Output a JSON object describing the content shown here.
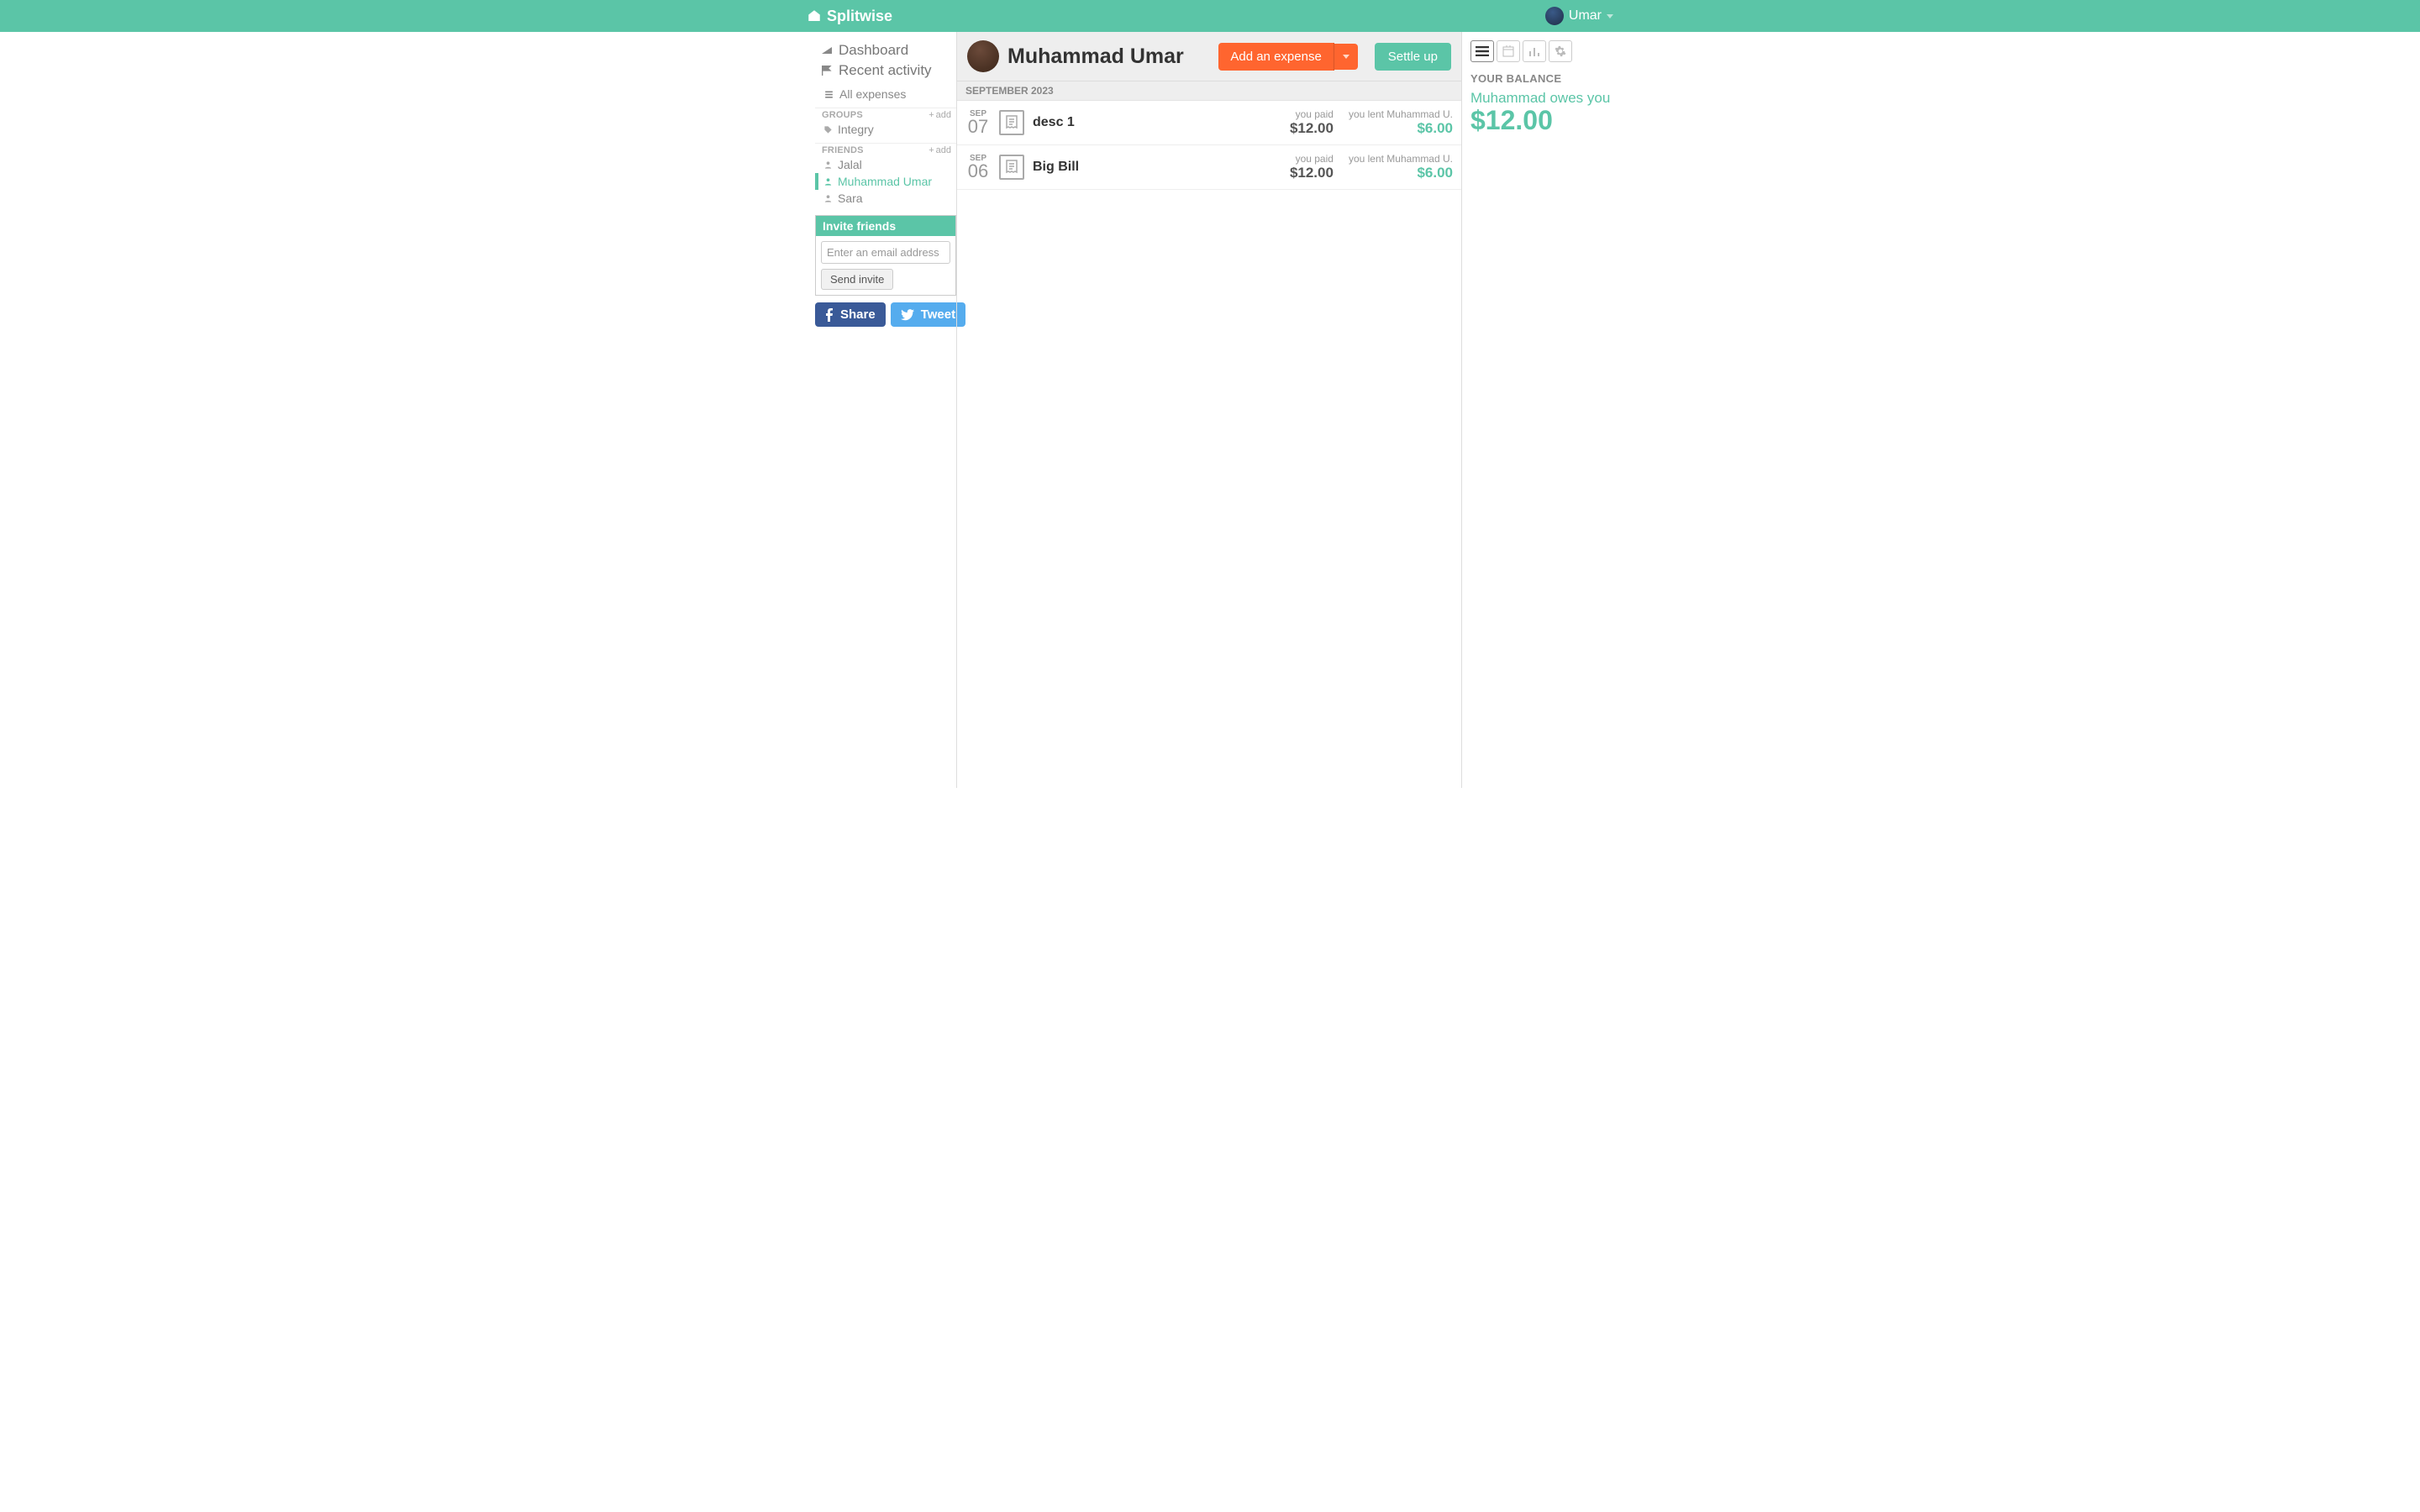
{
  "brand": "Splitwise",
  "user": {
    "name": "Umar"
  },
  "sidebar": {
    "dashboard": "Dashboard",
    "recent": "Recent activity",
    "all_expenses": "All expenses",
    "groups_label": "GROUPS",
    "friends_label": "FRIENDS",
    "add": "add",
    "groups": [
      {
        "name": "Integry"
      }
    ],
    "friends": [
      {
        "name": "Jalal"
      },
      {
        "name": "Muhammad Umar"
      },
      {
        "name": "Sara"
      }
    ]
  },
  "invite": {
    "title": "Invite friends",
    "placeholder": "Enter an email address",
    "send": "Send invite"
  },
  "social": {
    "share": "Share",
    "tweet": "Tweet"
  },
  "main": {
    "title": "Muhammad Umar",
    "add_expense": "Add an expense",
    "settle_up": "Settle up",
    "month_header": "SEPTEMBER 2023",
    "expenses": [
      {
        "month": "SEP",
        "day": "07",
        "desc": "desc 1",
        "paid_label": "you paid",
        "paid_amount": "$12.00",
        "lent_label": "you lent Muhammad U.",
        "lent_amount": "$6.00"
      },
      {
        "month": "SEP",
        "day": "06",
        "desc": "Big Bill",
        "paid_label": "you paid",
        "paid_amount": "$12.00",
        "lent_label": "you lent Muhammad U.",
        "lent_amount": "$6.00"
      }
    ]
  },
  "right": {
    "balance_head": "YOUR BALANCE",
    "balance_text": "Muhammad owes you",
    "balance_amount": "$12.00"
  }
}
